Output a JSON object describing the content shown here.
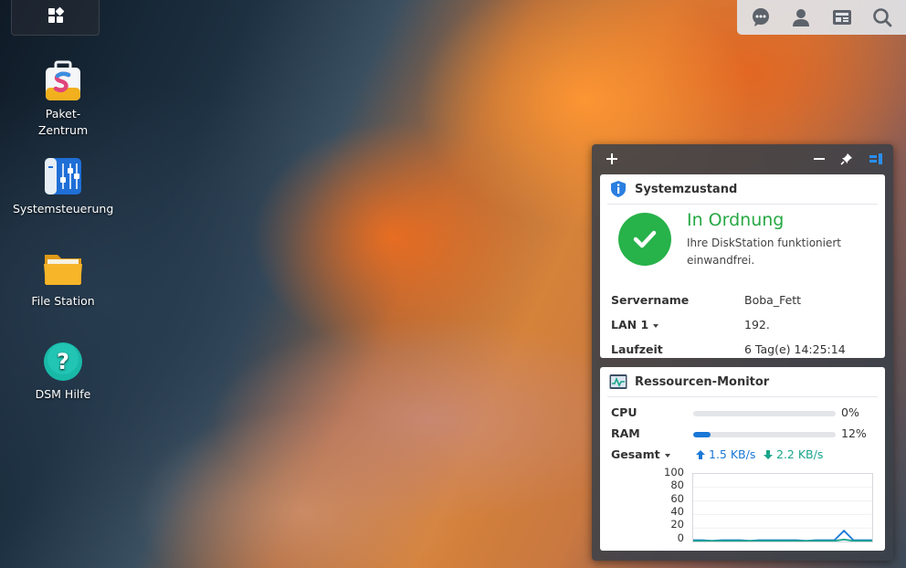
{
  "taskbar": {
    "main_menu_icon": "grid-icon",
    "tray_icons": [
      "chat-icon",
      "user-icon",
      "widgets-icon",
      "search-icon"
    ]
  },
  "desktop": {
    "icons": [
      {
        "label": "Paket-\nZentrum",
        "icon": "package-center-icon"
      },
      {
        "label": "Systemsteuerung",
        "icon": "control-panel-icon"
      },
      {
        "label": "File Station",
        "icon": "folder-icon"
      },
      {
        "label": "DSM Hilfe",
        "icon": "help-icon"
      }
    ]
  },
  "widget_panel": {
    "add_icon": "plus-icon",
    "minimize_icon": "minus-icon",
    "pin_icon": "pin-icon",
    "layout_icon": "panel-layout-icon",
    "system_health": {
      "title": "Systemzustand",
      "status_title": "In Ordnung",
      "status_desc": "Ihre DiskStation funktioniert einwandfrei.",
      "rows": [
        {
          "key": "Servername",
          "value": "Boba_Fett"
        },
        {
          "key": "LAN 1",
          "value": "192."
        },
        {
          "key": "Laufzeit",
          "value": "6 Tag(e) 14:25:14"
        }
      ]
    },
    "resource_monitor": {
      "title": "Ressourcen-Monitor",
      "cpu_label": "CPU",
      "cpu_value": "0%",
      "cpu_fraction": 0.0,
      "ram_label": "RAM",
      "ram_value": "12%",
      "ram_fraction": 0.12,
      "net_label": "Gesamt",
      "upload": "1.5 KB/s",
      "download": "2.2 KB/s",
      "colors": {
        "upload": "#1a78d6",
        "download": "#1aa58b",
        "ok": "#27b24a"
      }
    }
  },
  "chart_data": {
    "type": "line",
    "ylim": [
      0,
      100
    ],
    "yticks": [
      "100",
      "80",
      "60",
      "40",
      "20",
      "0"
    ],
    "series": [
      {
        "values": [
          2,
          2,
          1,
          2,
          2,
          2,
          1,
          2,
          2,
          2,
          2,
          2,
          1,
          2,
          2,
          2,
          16,
          2,
          2,
          2
        ]
      },
      {
        "values": [
          1,
          1,
          1,
          1,
          1,
          1,
          1,
          1,
          1,
          1,
          1,
          1,
          1,
          1,
          1,
          1,
          3,
          1,
          1,
          1
        ]
      }
    ]
  }
}
